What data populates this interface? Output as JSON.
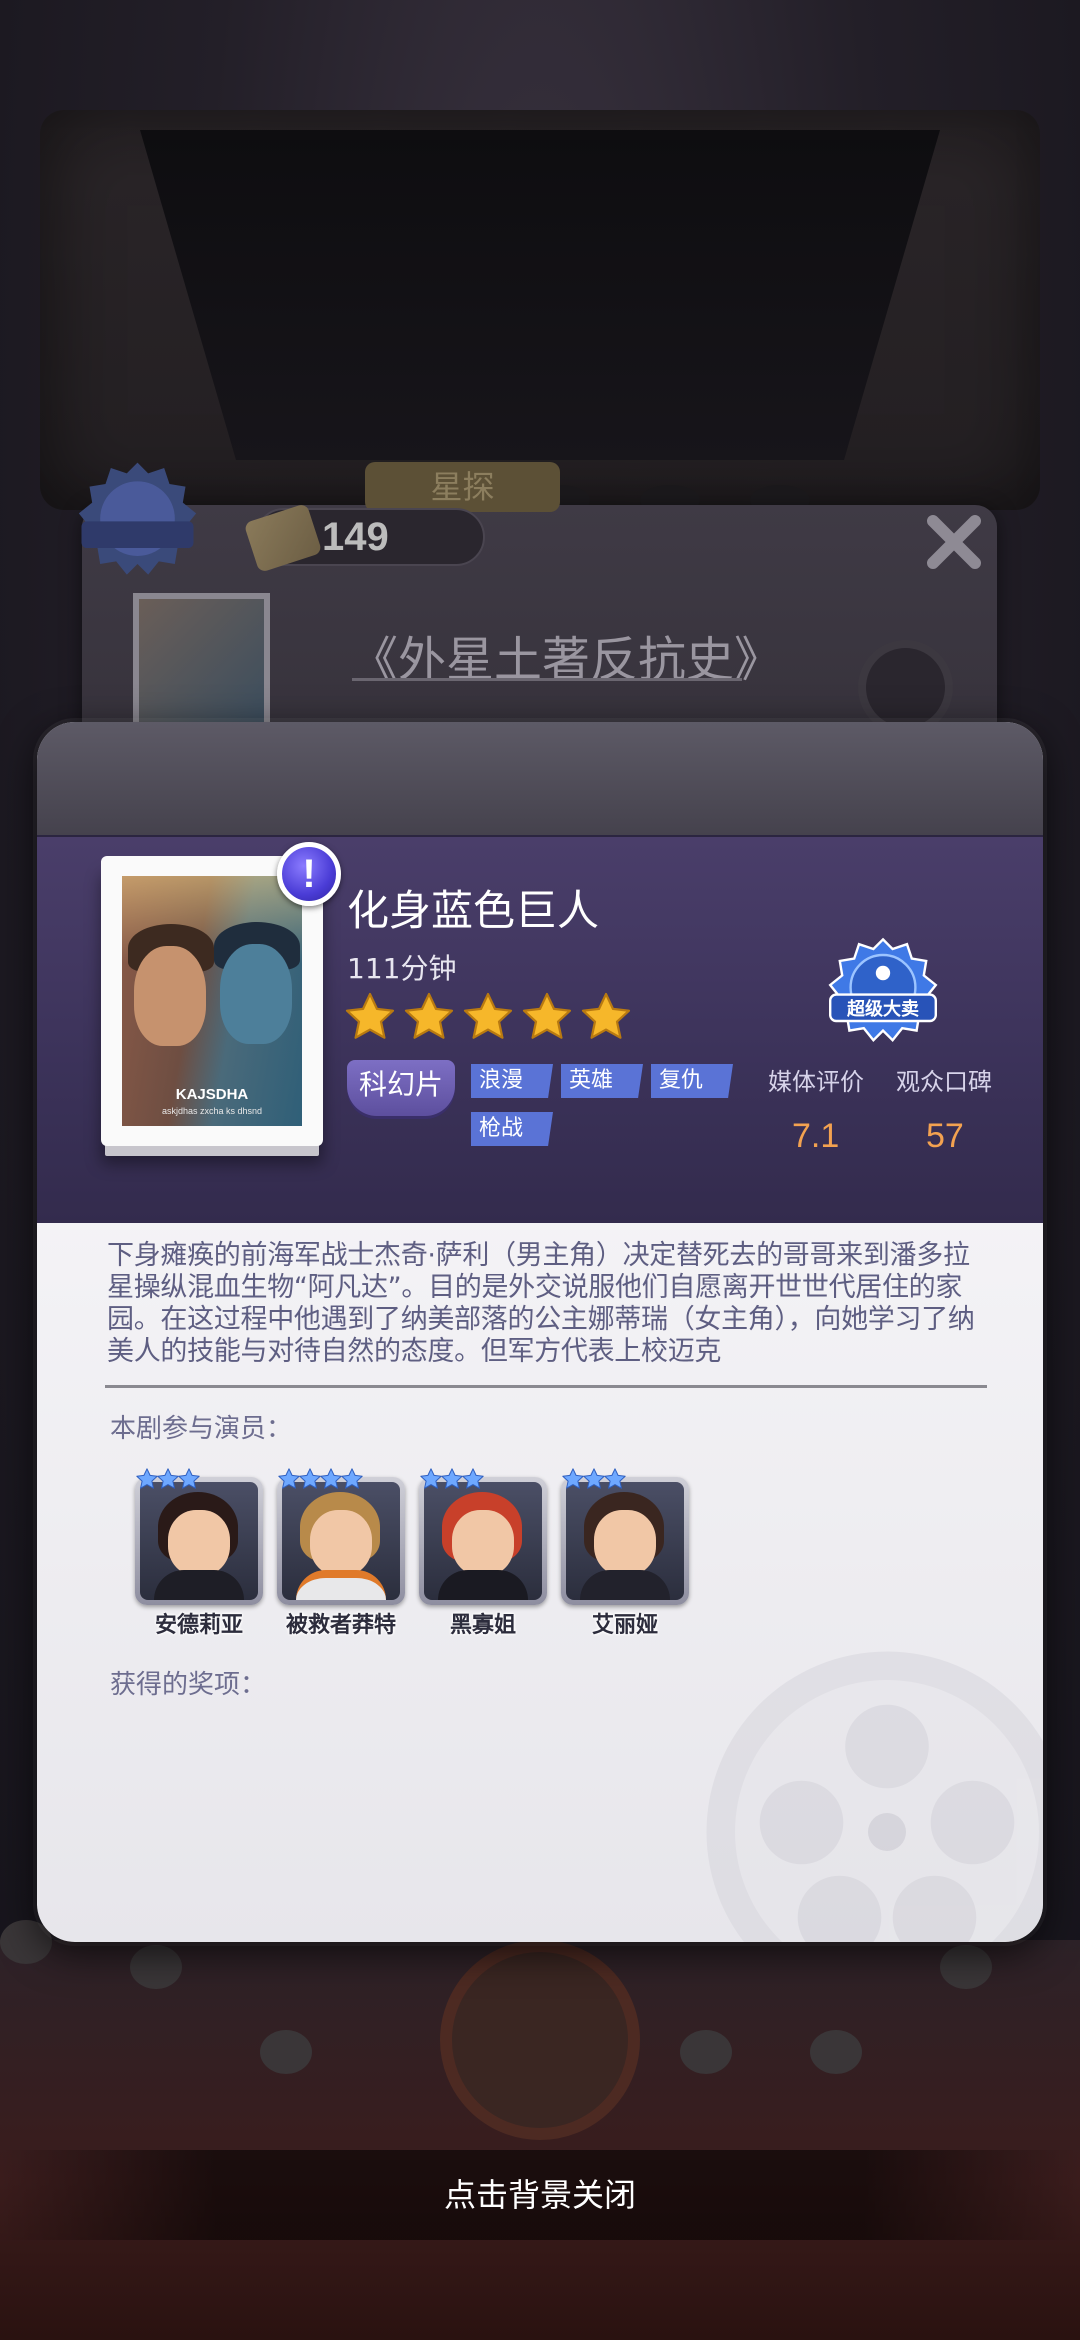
{
  "background": {
    "coins": "149",
    "scout_tag": "星探",
    "movie_title": "《外星土著反抗史》",
    "badge_label": "超级大卖"
  },
  "movie": {
    "title": "化身蓝色巨人",
    "duration": "111分钟",
    "rating_stars": 5,
    "poster_caption": "KAJSDHA",
    "poster_subcaption": "askjdhas zxcha ks dhsnd",
    "main_genre": "科幻片",
    "tags": [
      "浪漫",
      "英雄",
      "复仇",
      "枪战"
    ],
    "badge_label": "超级大卖",
    "media_rating_label": "媒体评价",
    "audience_rating_label": "观众口碑",
    "media_rating": "7.1",
    "audience_rating": "57",
    "synopsis": "下身瘫痪的前海军战士杰奇·萨利（男主角）决定替死去的哥哥来到潘多拉星操纵混血生物“阿凡达”。目的是外交说服他们自愿离开世世代居住的家园。在这过程中他遇到了纳美部落的公主娜蒂瑞（女主角），向她学习了纳美人的技能与对待自然的态度。但军方代表上校迈克"
  },
  "cast": {
    "label": "本剧参与演员：",
    "members": [
      {
        "name": "安德莉亚",
        "stars": 3
      },
      {
        "name": "被救者莽特",
        "stars": 4
      },
      {
        "name": "黑寡姐",
        "stars": 3
      },
      {
        "name": "艾丽娅",
        "stars": 3
      }
    ]
  },
  "awards": {
    "label": "获得的奖项："
  },
  "footer": {
    "hint": "点击背景关闭"
  },
  "colors": {
    "accent_purple": "#3b3259",
    "tag_blue": "#5a73d6",
    "rating_orange": "#f3a250",
    "star_gold": "#f6b72a"
  }
}
